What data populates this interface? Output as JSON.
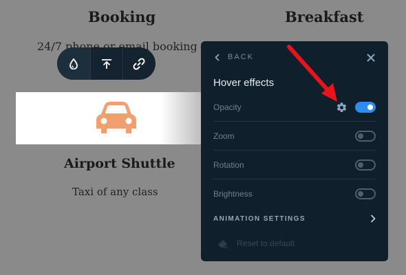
{
  "background": {
    "columns": [
      {
        "title": "Booking",
        "subtitle": "24/7 phone or email booking"
      },
      {
        "title": "Breakfast"
      }
    ],
    "card": {
      "title": "Airport Shuttle",
      "subtitle": "Taxi of any class",
      "icon": "car-icon",
      "icon_color": "#f0a070"
    }
  },
  "toolbar": {
    "buttons": [
      {
        "icon": "drop-icon"
      },
      {
        "icon": "align-top-icon"
      },
      {
        "icon": "link-icon"
      }
    ]
  },
  "panel": {
    "back_label": "BACK",
    "title": "Hover effects",
    "effects": [
      {
        "label": "Opacity",
        "enabled": true
      },
      {
        "label": "Zoom",
        "enabled": false
      },
      {
        "label": "Rotation",
        "enabled": false
      },
      {
        "label": "Brightness",
        "enabled": false
      }
    ],
    "animation_settings_label": "ANIMATION SETTINGS",
    "reset_label": "Reset to default",
    "accent_color": "#2c8cf0"
  },
  "annotation": {
    "arrow_color": "#e8141a"
  }
}
